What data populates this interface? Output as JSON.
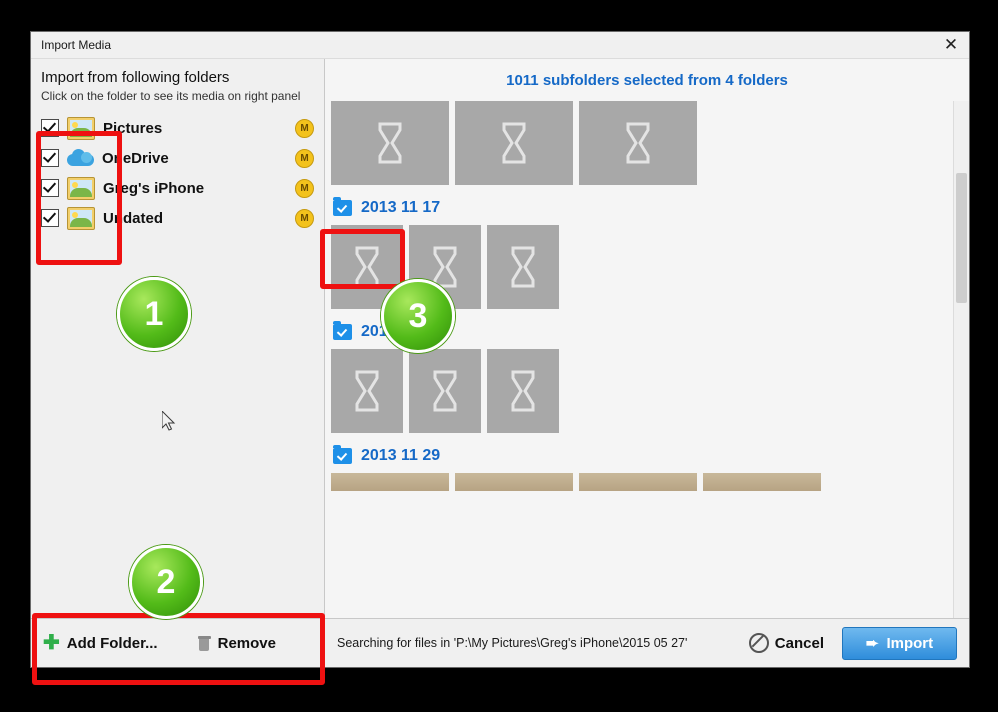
{
  "window": {
    "title": "Import Media",
    "close_icon": "close-icon"
  },
  "left": {
    "heading": "Import from following folders",
    "subheading": "Click on the folder to see its media on right panel",
    "folders": [
      {
        "label": "Pictures",
        "icon": "picture-icon",
        "badge": "M",
        "checked": true
      },
      {
        "label": "OneDrive",
        "icon": "cloud-icon",
        "badge": "M",
        "checked": true
      },
      {
        "label": "Greg's iPhone",
        "icon": "picture-icon",
        "badge": "M",
        "checked": true
      },
      {
        "label": "Undated",
        "icon": "picture-icon",
        "badge": "M",
        "checked": true
      }
    ],
    "add_folder_label": "Add Folder...",
    "remove_label": "Remove"
  },
  "right": {
    "header": "1011 subfolders selected from 4 folders",
    "groups": [
      {
        "title": "2013 11 17",
        "thumbs": 3
      },
      {
        "title": "2013 11 24",
        "thumbs": 3
      },
      {
        "title": "2013 11 29",
        "thumbs": 0
      }
    ],
    "status": "Searching for files in 'P:\\My Pictures\\Greg's iPhone\\2015 05 27'",
    "cancel_label": "Cancel",
    "import_label": "Import"
  },
  "annotations": {
    "badge1": "1",
    "badge2": "2",
    "badge3": "3",
    "box_color": "#ee1111",
    "badge_color": "#53bb19"
  }
}
